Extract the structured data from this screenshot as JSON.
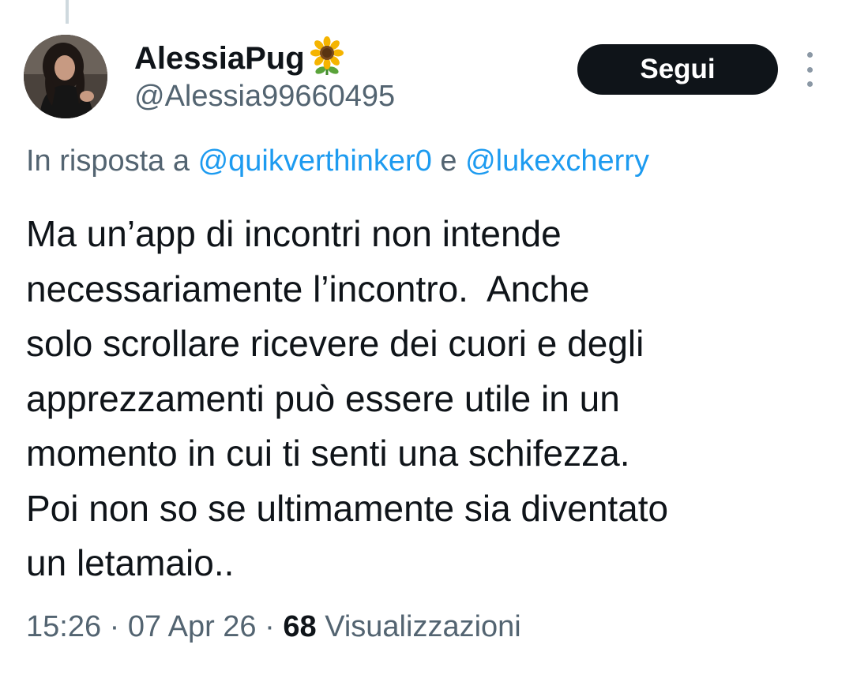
{
  "author": {
    "display_name": "AlessiaPug",
    "name_emoji": "sunflower-icon",
    "handle": "@Alessia99660495",
    "avatar": "profile-photo"
  },
  "actions": {
    "follow_label": "Segui",
    "more_icon": "more-vertical-icon"
  },
  "reply": {
    "prefix": "In risposta a",
    "mention_1": "@quikverthinker0",
    "conjunction": "e",
    "mention_2": "@lukexcherry"
  },
  "tweet": {
    "lines": [
      "Ma un’app di incontri non intende",
      "necessariamente l’incontro.  Anche",
      "solo scrollare ricevere dei cuori e degli",
      "apprezzamenti può essere utile in un",
      "momento in cui ti senti una schifezza.",
      "Poi non so se ultimamente sia diventato",
      "un letamaio.."
    ]
  },
  "meta": {
    "time": "15:26",
    "separator": "·",
    "date": "07 Apr 26",
    "views_count": "68",
    "views_label": "Visualizzazioni"
  },
  "colors": {
    "text": "#0f1419",
    "muted": "#536471",
    "link": "#1d9bf0",
    "button_bg": "#0f1419",
    "button_text": "#ffffff"
  }
}
